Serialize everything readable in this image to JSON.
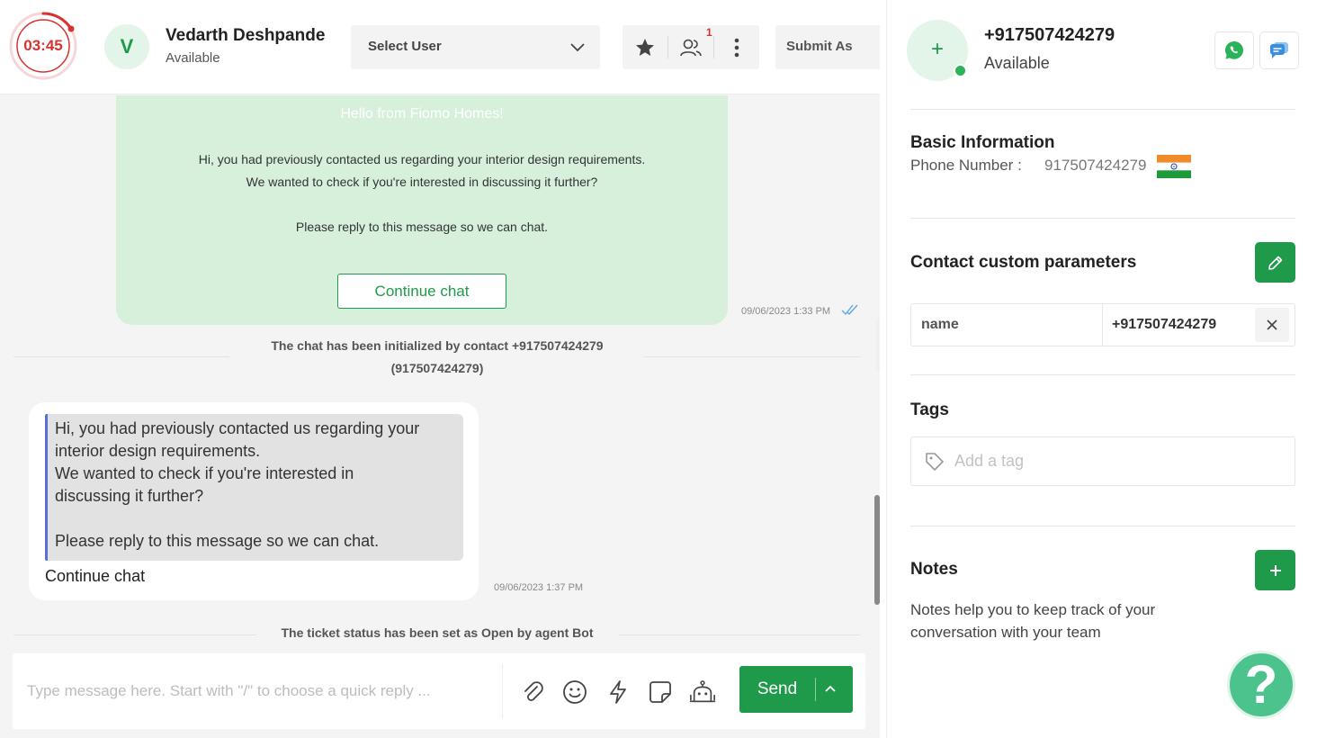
{
  "header": {
    "timer": "03:45",
    "agent": {
      "initial": "V",
      "name": "Vedarth Deshpande",
      "status": "Available"
    },
    "select_user": {
      "label": "Select User"
    },
    "toolbar": {
      "participants_badge": "1"
    },
    "submit_as_label": "Submit As"
  },
  "chat": {
    "template_message": {
      "header": "Hello from Fiomo Homes!",
      "lines": [
        "Hi, you had previously contacted us regarding your interior design requirements.",
        "We wanted to check if you're interested in discussing it further?",
        "Please reply to this message so we can chat."
      ],
      "button": "Continue chat",
      "timestamp": "09/06/2023 1:33 PM"
    },
    "system_message_1": {
      "line1": "The chat has been initialized by contact +917507424279",
      "line2": "(917507424279)"
    },
    "customer_message": {
      "quoted_lines": [
        "Hi, you had previously contacted us regarding your",
        "interior design requirements.",
        "We wanted to check if you're interested in",
        "discussing it further?",
        "Please reply to this message so we can chat."
      ],
      "reply": "Continue chat",
      "timestamp": "09/06/2023 1:37 PM"
    },
    "system_message_2": "The ticket status has been set as Open by agent Bot"
  },
  "composer": {
    "placeholder": "Type message here. Start with \"/\" to choose a quick reply ...",
    "send_label": "Send"
  },
  "contact": {
    "phone": "+917507424279",
    "status": "Available",
    "basic_info": {
      "title": "Basic Information",
      "phone_label": "Phone Number :",
      "phone_value": "917507424279"
    },
    "custom_params": {
      "title": "Contact custom parameters",
      "rows": [
        {
          "key": "name",
          "value": "+917507424279"
        }
      ]
    },
    "tags": {
      "title": "Tags",
      "placeholder": "Add a tag"
    },
    "notes": {
      "title": "Notes",
      "help": "Notes help you to keep track of your conversation with your team"
    }
  },
  "colors": {
    "brand_green": "#1f9a4a",
    "timer_red": "#d93030",
    "template_bubble": "#d6f0dc",
    "help_fab": "#4cc28c"
  }
}
